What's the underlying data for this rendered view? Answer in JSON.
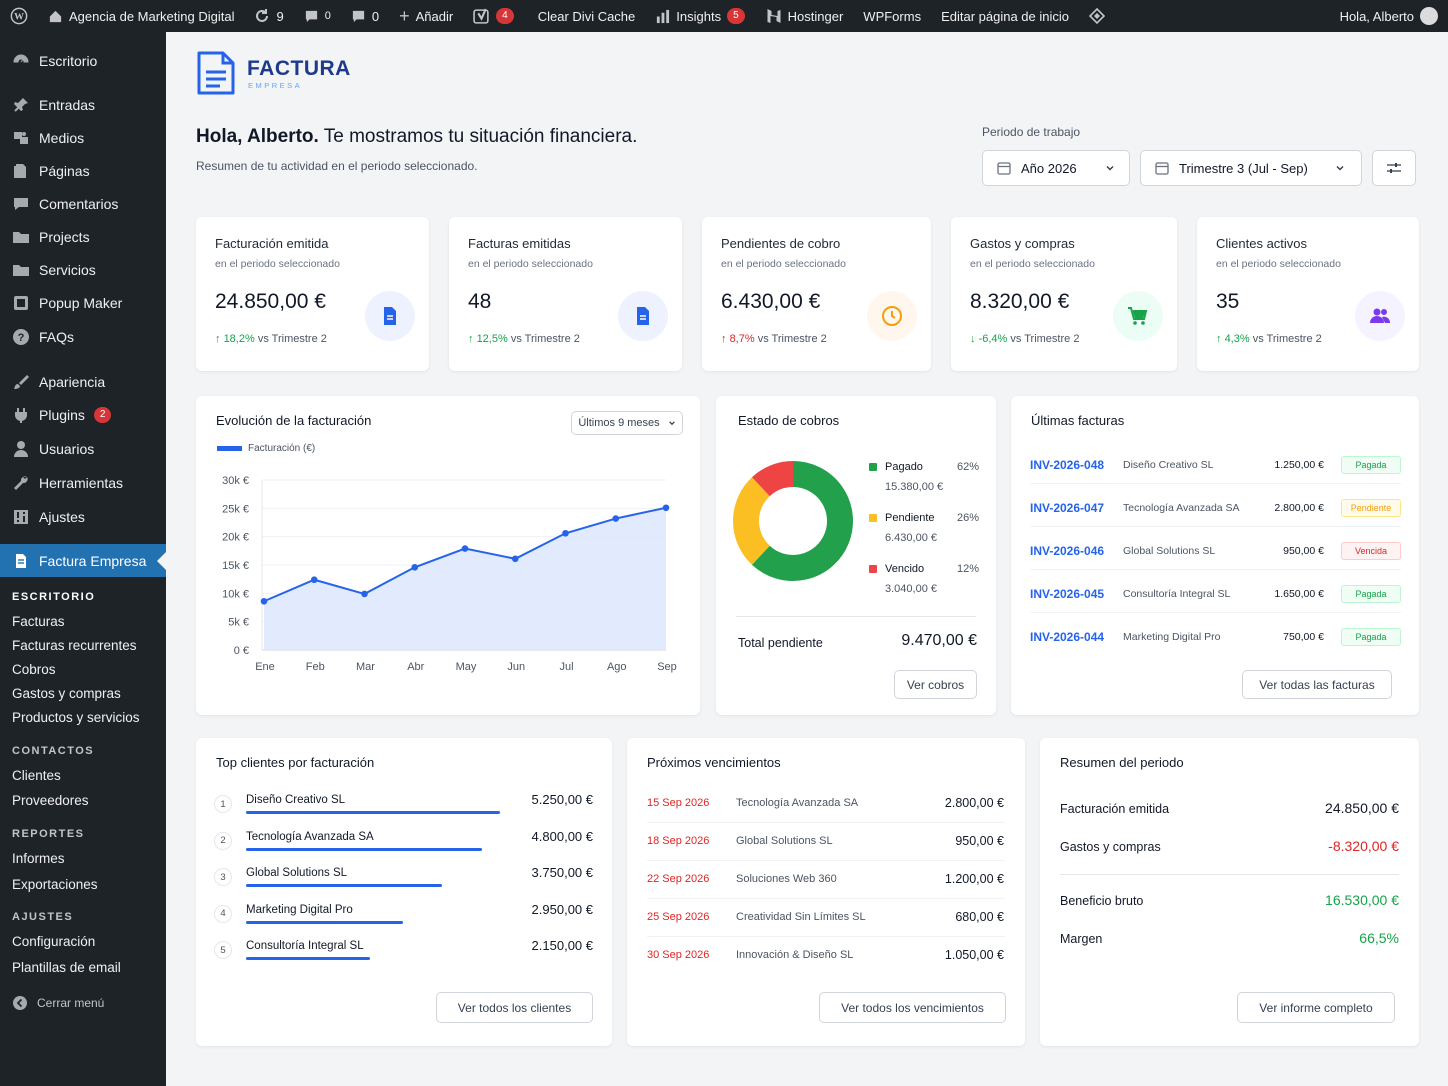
{
  "adminbar": {
    "site": "Agencia de Marketing Digital",
    "updates": "9",
    "comments_pending": "0",
    "comments": "0",
    "new": "Añadir",
    "yoast_badge": "4",
    "divi": "Clear Divi Cache",
    "insights": "Insights",
    "insights_badge": "5",
    "hostinger": "Hostinger",
    "wpforms": "WPForms",
    "edit_home": "Editar página de inicio",
    "greeting": "Hola, Alberto"
  },
  "sidebar": {
    "items": [
      {
        "label": "Escritorio",
        "icon": "dashboard-icon"
      },
      {
        "label": "Entradas",
        "icon": "pin-icon"
      },
      {
        "label": "Medios",
        "icon": "media-icon"
      },
      {
        "label": "Páginas",
        "icon": "page-icon"
      },
      {
        "label": "Comentarios",
        "icon": "comment-icon"
      },
      {
        "label": "Projects",
        "icon": "folder-icon"
      },
      {
        "label": "Servicios",
        "icon": "folder-icon"
      },
      {
        "label": "Popup Maker",
        "icon": "popup-icon"
      },
      {
        "label": "FAQs",
        "icon": "help-icon"
      },
      {
        "label": "Apariencia",
        "icon": "brush-icon"
      },
      {
        "label": "Plugins",
        "icon": "plugin-icon",
        "badge": "2"
      },
      {
        "label": "Usuarios",
        "icon": "user-icon"
      },
      {
        "label": "Herramientas",
        "icon": "wrench-icon"
      },
      {
        "label": "Ajustes",
        "icon": "settings-icon"
      },
      {
        "label": "Factura Empresa",
        "icon": "invoice-icon"
      }
    ],
    "groups": [
      {
        "title": "ESCRITORIO",
        "items": [
          "Facturas",
          "Facturas recurrentes",
          "Cobros",
          "Gastos y compras",
          "Productos y servicios"
        ]
      },
      {
        "title": "CONTACTOS",
        "items": [
          "Clientes",
          "Proveedores"
        ]
      },
      {
        "title": "REPORTES",
        "items": [
          "Informes",
          "Exportaciones"
        ]
      },
      {
        "title": "AJUSTES",
        "items": [
          "Configuración",
          "Plantillas de email"
        ]
      }
    ],
    "collapse": "Cerrar menú"
  },
  "brand": {
    "name": "FACTURA",
    "sub": "EMPRESA"
  },
  "header": {
    "greeting_strong": "Hola, Alberto.",
    "greeting_rest": " Te mostramos tu situación financiera.",
    "subtitle": "Resumen de tu actividad en el periodo seleccionado.",
    "period_label": "Periodo de trabajo",
    "year": "Año 2026",
    "quarter": "Trimestre 3 (Jul - Sep)"
  },
  "kpis": [
    {
      "title": "Facturación emitida",
      "sub": "en el periodo seleccionado",
      "value": "24.850,00 €",
      "change": "18,2%",
      "vs": " vs Trimestre 2",
      "dir": "up",
      "icon": "document-icon",
      "color": "#2563eb",
      "bg": "#eef2ff"
    },
    {
      "title": "Facturas emitidas",
      "sub": "en el periodo seleccionado",
      "value": "48",
      "change": "12,5%",
      "vs": " vs Trimestre 2",
      "dir": "up",
      "icon": "document-icon",
      "color": "#2563eb",
      "bg": "#eef2ff"
    },
    {
      "title": "Pendientes de cobro",
      "sub": "en el periodo seleccionado",
      "value": "6.430,00 €",
      "change": "8,7%",
      "vs": " vs Trimestre 2",
      "dir": "up-red",
      "icon": "clock-icon",
      "color": "#f59e0b",
      "bg": "#fff7ed"
    },
    {
      "title": "Gastos y compras",
      "sub": "en el periodo seleccionado",
      "value": "8.320,00 €",
      "change": "-6,4%",
      "vs": " vs Trimestre 2",
      "dir": "down",
      "icon": "cart-icon",
      "color": "#16a34a",
      "bg": "#ecfdf5"
    },
    {
      "title": "Clientes activos",
      "sub": "en el periodo seleccionado",
      "value": "35",
      "change": "4,3%",
      "vs": " vs Trimestre 2",
      "dir": "up",
      "icon": "users-icon",
      "color": "#7c3aed",
      "bg": "#f5f3ff"
    }
  ],
  "evolution": {
    "title": "Evolución de la facturación",
    "range": "Últimos 9 meses"
  },
  "chart_data": {
    "type": "area",
    "title": "",
    "series": [
      {
        "name": "Facturación (€)",
        "values": [
          8600,
          12400,
          9900,
          14600,
          17900,
          16100,
          20600,
          23200,
          25100
        ]
      }
    ],
    "categories": [
      "Ene",
      "Feb",
      "Mar",
      "Abr",
      "May",
      "Jun",
      "Jul",
      "Ago",
      "Sep"
    ],
    "yticks": [
      "0 €",
      "5k €",
      "10k €",
      "15k €",
      "20k €",
      "25k €",
      "30k €"
    ],
    "ylim": [
      0,
      30000
    ],
    "color": "#2563eb",
    "grid": true,
    "legend": "top-left"
  },
  "cobros": {
    "title": "Estado de cobros",
    "items": [
      {
        "label": "Pagado",
        "pct": "62%",
        "amount": "15.380,00 €",
        "value": 62,
        "color": "#22a04b"
      },
      {
        "label": "Pendiente",
        "pct": "26%",
        "amount": "6.430,00 €",
        "value": 26,
        "color": "#fbbf24"
      },
      {
        "label": "Vencido",
        "pct": "12%",
        "amount": "3.040,00 €",
        "value": 12,
        "color": "#ef4444"
      }
    ],
    "total_label": "Total pendiente",
    "total": "9.470,00 €",
    "button": "Ver cobros"
  },
  "invoices": {
    "title": "Últimas facturas",
    "rows": [
      {
        "id": "INV-2026-048",
        "client": "Diseño Creativo SL",
        "amount": "1.250,00 €",
        "status": "Pagada",
        "type": "paid"
      },
      {
        "id": "INV-2026-047",
        "client": "Tecnología Avanzada SA",
        "amount": "2.800,00 €",
        "status": "Pendiente",
        "type": "pending"
      },
      {
        "id": "INV-2026-046",
        "client": "Global Solutions SL",
        "amount": "950,00 €",
        "status": "Vencida",
        "type": "overdue"
      },
      {
        "id": "INV-2026-045",
        "client": "Consultoría Integral SL",
        "amount": "1.650,00 €",
        "status": "Pagada",
        "type": "paid"
      },
      {
        "id": "INV-2026-044",
        "client": "Marketing Digital Pro",
        "amount": "750,00 €",
        "status": "Pagada",
        "type": "paid"
      }
    ],
    "button": "Ver todas las facturas"
  },
  "top_clients": {
    "title": "Top clientes por facturación",
    "rows": [
      {
        "rank": "1",
        "name": "Diseño Creativo SL",
        "amount": "5.250,00 €",
        "share": 1.0
      },
      {
        "rank": "2",
        "name": "Tecnología Avanzada SA",
        "amount": "4.800,00 €",
        "share": 0.93
      },
      {
        "rank": "3",
        "name": "Global Solutions SL",
        "amount": "3.750,00 €",
        "share": 0.77
      },
      {
        "rank": "4",
        "name": "Marketing Digital Pro",
        "amount": "2.950,00 €",
        "share": 0.62
      },
      {
        "rank": "5",
        "name": "Consultoría Integral SL",
        "amount": "2.150,00 €",
        "share": 0.49
      }
    ],
    "button": "Ver todos los clientes"
  },
  "due": {
    "title": "Próximos vencimientos",
    "rows": [
      {
        "date": "15 Sep 2026",
        "client": "Tecnología Avanzada SA",
        "amount": "2.800,00 €"
      },
      {
        "date": "18 Sep 2026",
        "client": "Global Solutions SL",
        "amount": "950,00 €"
      },
      {
        "date": "22 Sep 2026",
        "client": "Soluciones Web 360",
        "amount": "1.200,00 €"
      },
      {
        "date": "25 Sep 2026",
        "client": "Creatividad Sin Límites SL",
        "amount": "680,00 €"
      },
      {
        "date": "30 Sep 2026",
        "client": "Innovación & Diseño SL",
        "amount": "1.050,00 €"
      }
    ],
    "button": "Ver todos los vencimientos"
  },
  "summary": {
    "title": "Resumen del periodo",
    "rows": [
      {
        "label": "Facturación emitida",
        "value": "24.850,00 €",
        "color": "#111827"
      },
      {
        "label": "Gastos y compras",
        "value": "-8.320,00 €",
        "color": "#dc2626"
      },
      {
        "label": "Beneficio bruto",
        "value": "16.530,00 €",
        "color": "#16a34a"
      },
      {
        "label": "Margen",
        "value": "66,5%",
        "color": "#16a34a"
      }
    ],
    "button": "Ver informe completo"
  }
}
